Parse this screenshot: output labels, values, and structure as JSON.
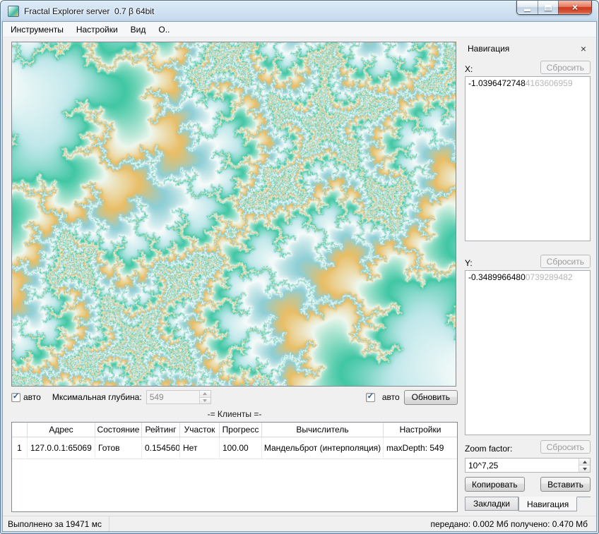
{
  "window": {
    "title": "Fractal Explorer server  0.7 β 64bit"
  },
  "icons": {
    "close": "×",
    "check": "✓"
  },
  "menu": {
    "items": [
      {
        "label": "Инструменты"
      },
      {
        "label": "Настройки"
      },
      {
        "label": "Вид"
      },
      {
        "label": "О.."
      }
    ]
  },
  "depth_controls": {
    "auto_checkbox_label": "авто",
    "max_depth_label": "Мксимальная глубина:",
    "max_depth_value": "549",
    "auto2_checkbox_label": "авто",
    "refresh_button_label": "Обновить"
  },
  "clients": {
    "section_title": "-= Клиенты =-",
    "columns": [
      "Адрес",
      "Состояние",
      "Рейтинг",
      "Участок",
      "Прогресс",
      "Вычислитель",
      "Настройки"
    ],
    "rows": [
      {
        "num": "1",
        "address": "127.0.0.1:65069",
        "state": "Готов",
        "rating": "0.154560",
        "region": "Нет",
        "progress": "100.00",
        "calculator": "Мандельброт (интерполяция)",
        "settings": "maxDepth: 549"
      }
    ]
  },
  "navigation": {
    "title": "Навигация",
    "x_label": "X:",
    "x_value": "-1.0396472748",
    "x_value_faded": "4163606959",
    "y_label": "Y:",
    "y_value": "-0.3489966480",
    "y_value_faded": "0739289482",
    "reset_button_label": "Сбросить",
    "zoom_label": "Zoom factor:",
    "zoom_value": "10^7,25",
    "copy_button_label": "Копировать",
    "paste_button_label": "Вставить",
    "tabs": [
      {
        "label": "Закладки",
        "active": false
      },
      {
        "label": "Навигация",
        "active": true
      }
    ]
  },
  "statusbar": {
    "left": "Выполнено за 19471 мс",
    "right": "передано: 0.002 Мб  получено: 0.470 Мб"
  },
  "fractal": {
    "center_x": -1.039647274841636,
    "center_y": -0.3489966480073929,
    "zoom_exponent": 7.25,
    "max_depth": 549,
    "interior_color": "#2fa69b",
    "palette": [
      "#f7fbfa",
      "#bfe7ea",
      "#41c7a4",
      "#eef7ee",
      "#e9be66",
      "#8ecfd6"
    ]
  }
}
